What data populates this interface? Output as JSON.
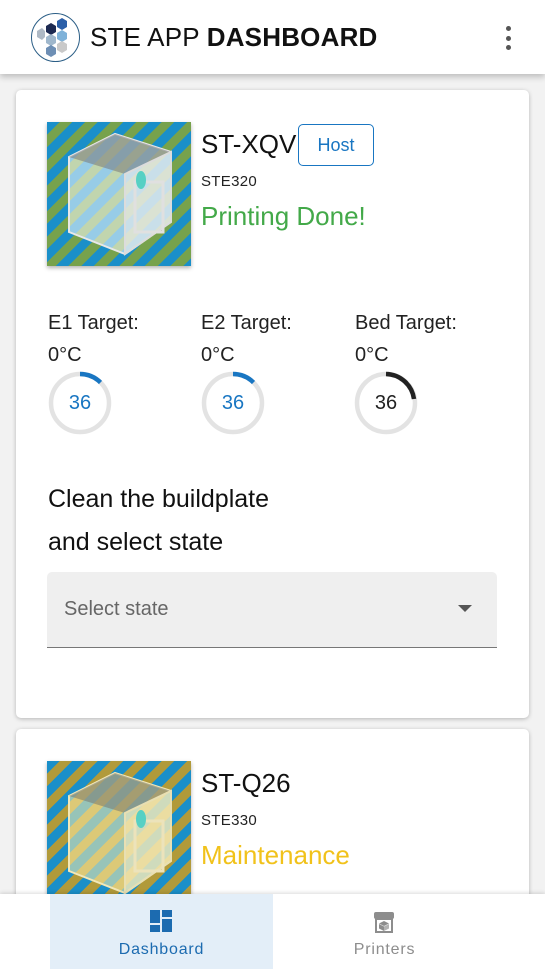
{
  "app": {
    "title_prefix": "STE APP ",
    "title_bold": "DASHBOARD"
  },
  "printers": [
    {
      "name": "ST-XQV",
      "host_label": "Host",
      "model": "STE320",
      "status": "Printing Done!",
      "status_color": "#43a949",
      "temps": [
        {
          "label": "E1 Target:",
          "value": "0°C",
          "gauge": "36",
          "color": "#1976c2"
        },
        {
          "label": "E2 Target:",
          "value": "0°C",
          "gauge": "36",
          "color": "#1976c2"
        },
        {
          "label": "Bed Target:",
          "value": "0°C",
          "gauge": "36",
          "color": "#222222"
        }
      ],
      "instruction_line1": "Clean the buildplate",
      "instruction_line2": "and select state",
      "select_placeholder": "Select state"
    },
    {
      "name": "ST-Q26",
      "model": "STE330",
      "status": "Maintenance",
      "status_color": "#f1c21b"
    }
  ],
  "nav": {
    "items": [
      {
        "label": "Dashboard",
        "icon": "dashboard-icon",
        "active": true
      },
      {
        "label": "Printers",
        "icon": "printer-icon",
        "active": false
      }
    ]
  },
  "colors": {
    "accent": "#1976c2",
    "active_nav_bg": "#e3eef8",
    "done": "#43a949",
    "maintenance": "#f1c21b"
  }
}
